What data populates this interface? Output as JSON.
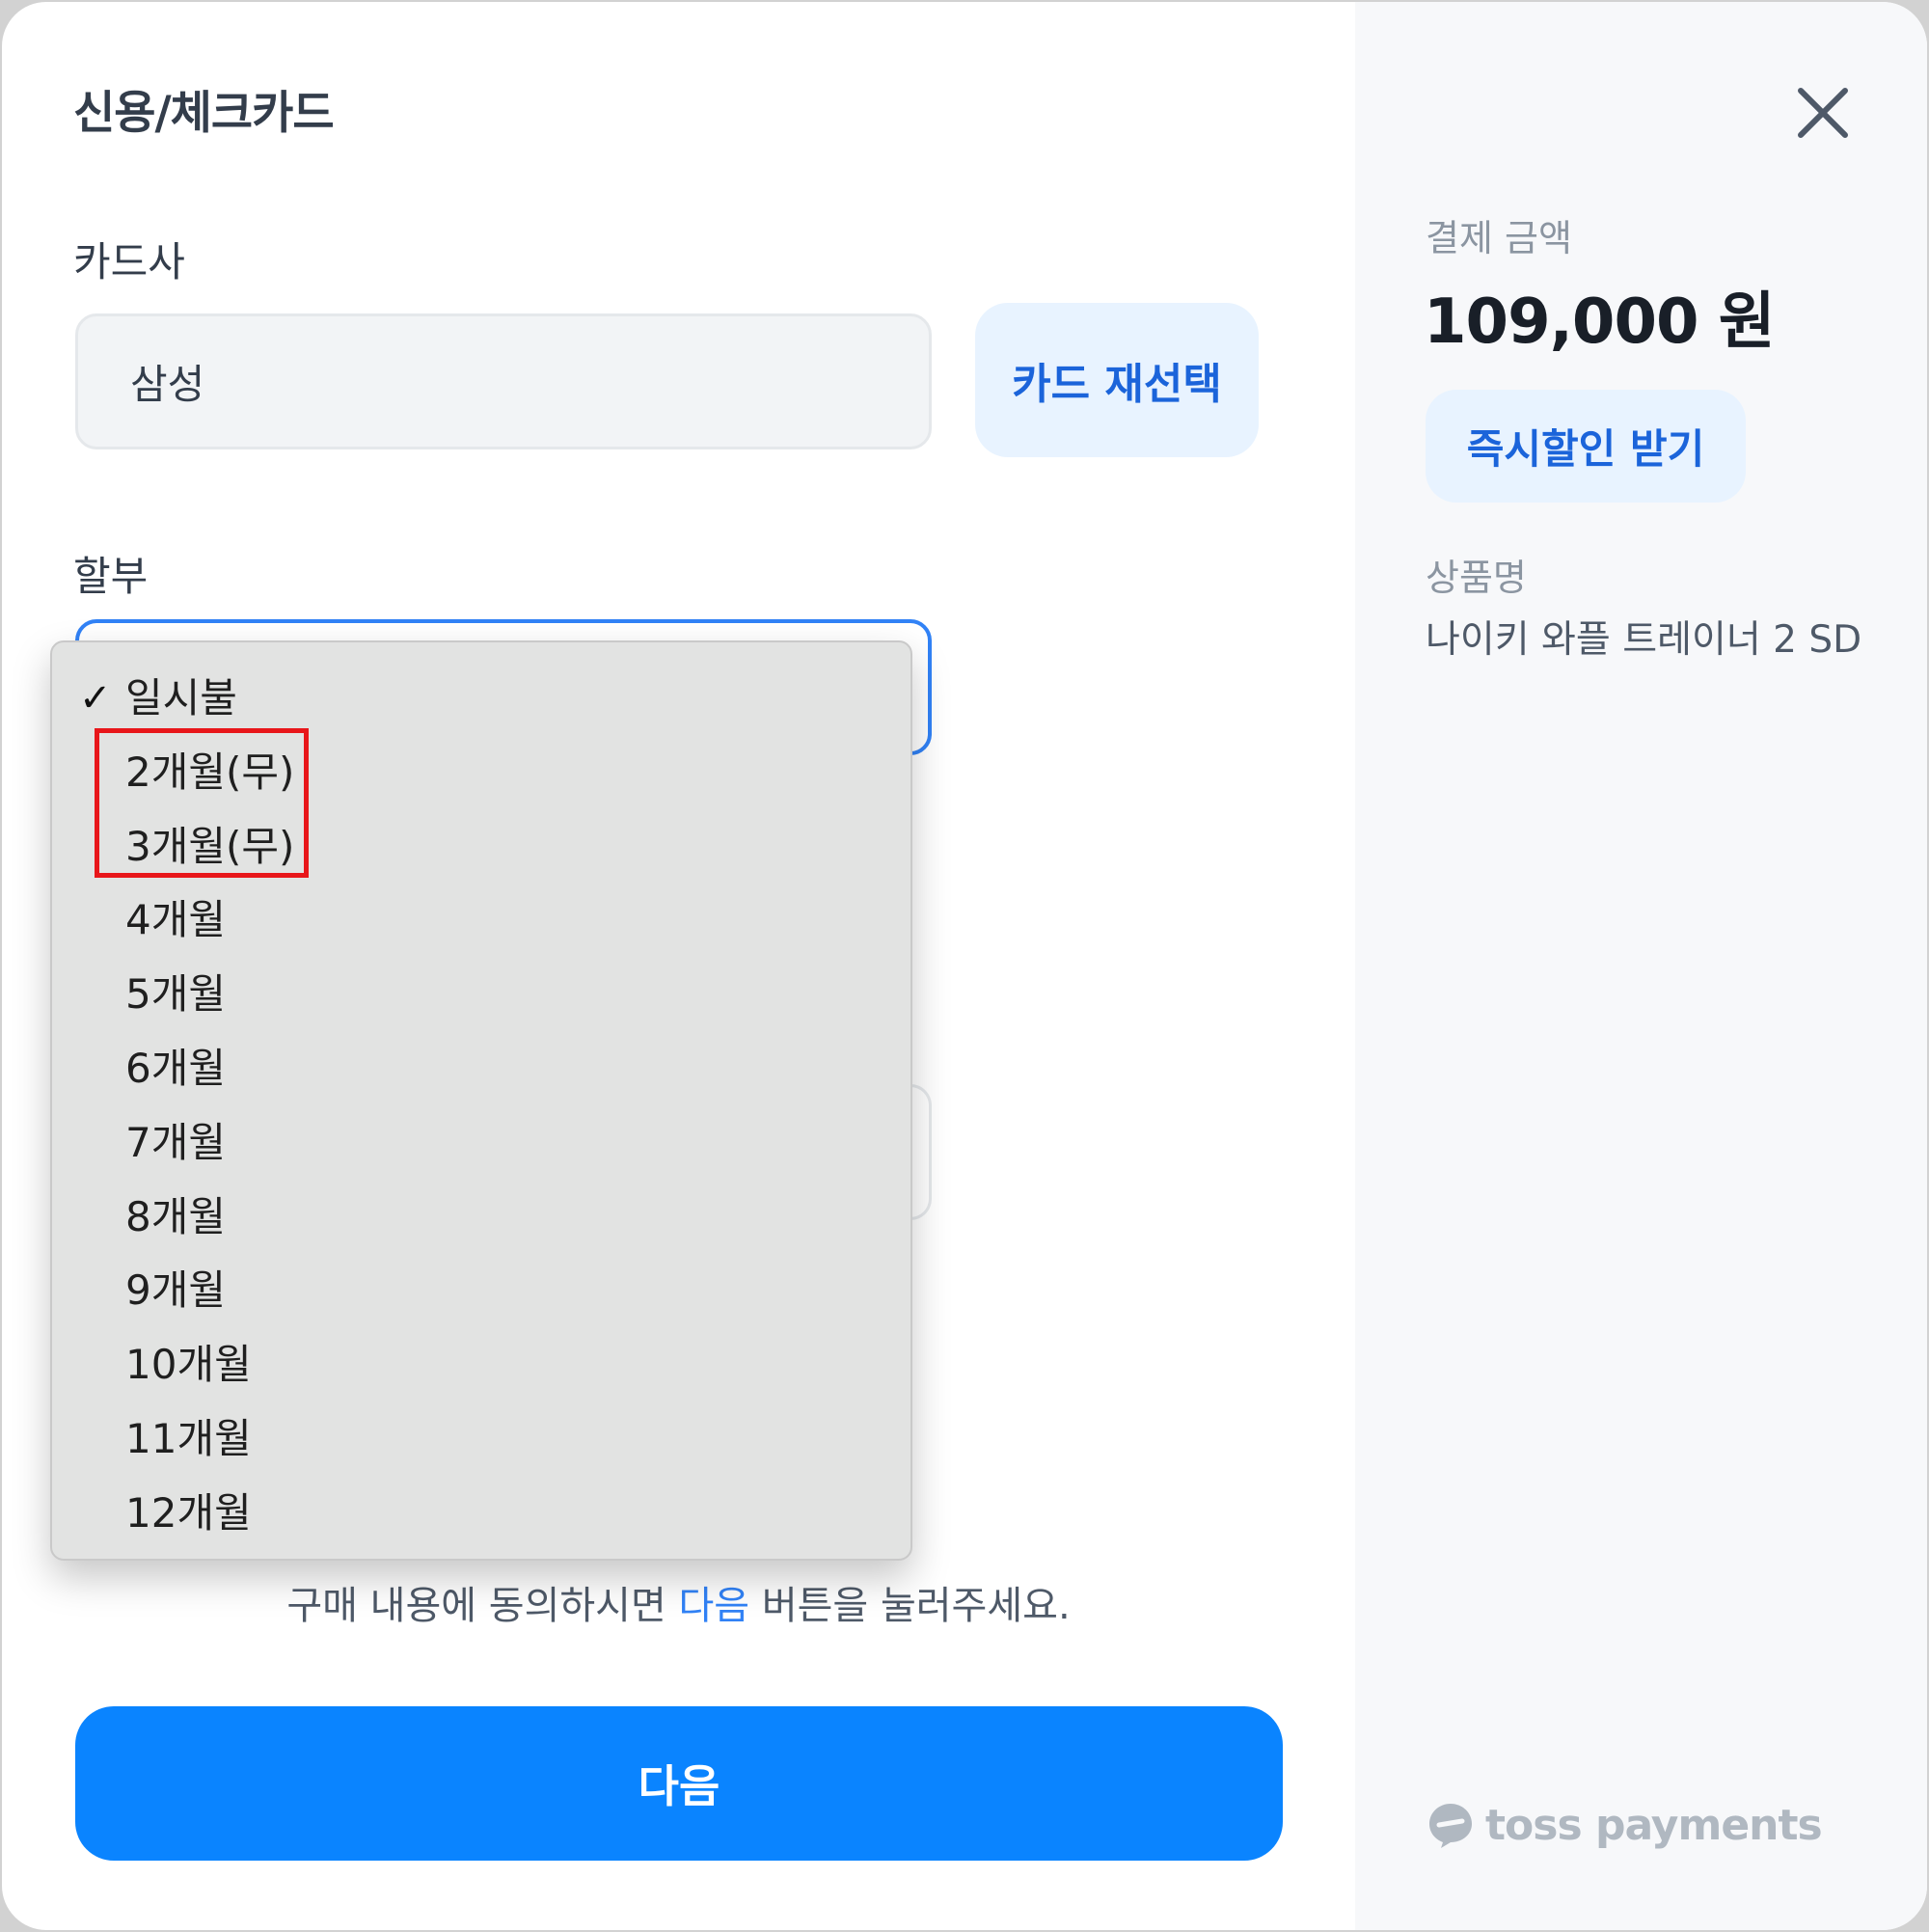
{
  "page": {
    "title": "신용/체크카드",
    "close_icon": "close-icon"
  },
  "card_company": {
    "label": "카드사",
    "value": "삼성",
    "reselect_label": "카드 재선택"
  },
  "installment": {
    "label": "할부",
    "selected": "일시불",
    "options": [
      "일시불",
      "2개월(무)",
      "3개월(무)",
      "4개월",
      "5개월",
      "6개월",
      "7개월",
      "8개월",
      "9개월",
      "10개월",
      "11개월",
      "12개월"
    ],
    "check_icon": "checkmark-icon"
  },
  "agreement": {
    "prefix": "구매 내용에 동의하시면 ",
    "highlight": "다음",
    "suffix": " 버튼을 눌러주세요."
  },
  "next_button": {
    "label": "다음"
  },
  "summary": {
    "amount_label": "결제 금액",
    "amount_value": "109,000 원",
    "discount_button": "즉시할인 받기",
    "product_label": "상품명",
    "product_name": "나이키 와플 트레이너 2 SD"
  },
  "brand": {
    "logo_text": "toss payments",
    "logo_icon": "toss-logo-icon"
  },
  "colors": {
    "primary": "#0a84ff",
    "accent_text": "#1b64da",
    "light_accent_bg": "#e8f3ff",
    "highlight_box": "#e8161a"
  }
}
